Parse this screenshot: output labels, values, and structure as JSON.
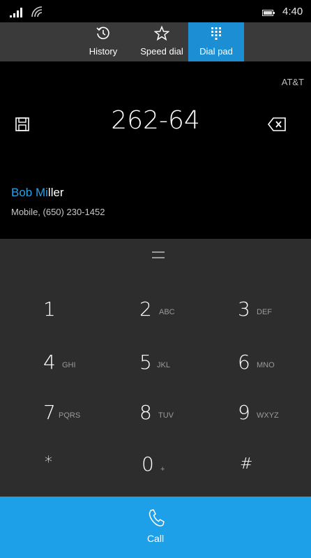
{
  "status_bar": {
    "time": "4:40",
    "signal_icon": "signal-bars-icon",
    "wifi_icon": "wifi-icon",
    "battery_icon": "battery-icon"
  },
  "tabs": [
    {
      "label": "History",
      "icon": "history-icon"
    },
    {
      "label": "Speed dial",
      "icon": "star-icon"
    },
    {
      "label": "Dial pad",
      "icon": "dialpad-icon",
      "selected": true
    }
  ],
  "carrier": "AT&T",
  "dialed_number": "262-64",
  "contact": {
    "name_match": "Bob Mi",
    "name_rest": "ller",
    "detail": "Mobile, (650) 230-1452"
  },
  "keypad": {
    "handle_icon": "drag-handle-icon",
    "keys": [
      {
        "digit": "1",
        "letters": ""
      },
      {
        "digit": "2",
        "letters": "ABC"
      },
      {
        "digit": "3",
        "letters": "DEF"
      },
      {
        "digit": "4",
        "letters": "GHI"
      },
      {
        "digit": "5",
        "letters": "JKL"
      },
      {
        "digit": "6",
        "letters": "MNO"
      },
      {
        "digit": "7",
        "letters": "PQRS"
      },
      {
        "digit": "8",
        "letters": "TUV"
      },
      {
        "digit": "9",
        "letters": "WXYZ"
      },
      {
        "digit": "*",
        "letters": ""
      },
      {
        "digit": "0",
        "letters": "+"
      },
      {
        "digit": "#",
        "letters": ""
      }
    ]
  },
  "call": {
    "label": "Call",
    "icon": "phone-icon"
  },
  "colors": {
    "accent": "#1c8ed4",
    "call_bg": "#1ea0e8",
    "keypad_bg": "#2d2d2d",
    "tabbar_bg": "#3a3a3a",
    "match_highlight": "#2aa0e6"
  }
}
